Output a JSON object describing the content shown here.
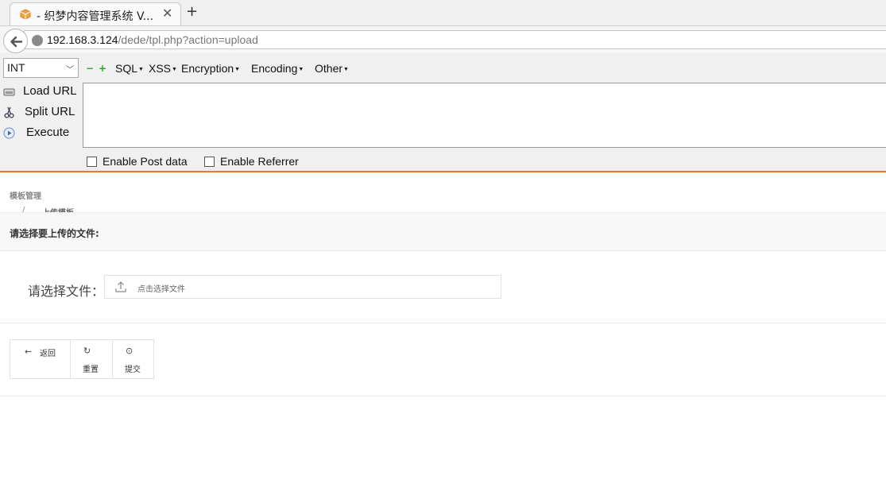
{
  "browser": {
    "tab_title": "- 织梦内容管理系统 V...",
    "tab_close": "✕",
    "new_tab": "+",
    "url_host": "192.168.3.124",
    "url_path": "/dede/tpl.php?action=upload"
  },
  "hackbar": {
    "select_value": "INT",
    "minus": "−",
    "plus": "+",
    "menus": [
      "SQL",
      "XSS",
      "Encryption",
      "Encoding",
      "Other"
    ],
    "load_url": "Load URL",
    "split_url": "Split URL",
    "execute": "Execute",
    "enable_post": "Enable Post data",
    "enable_referrer": "Enable Referrer"
  },
  "page": {
    "breadcrumb_parent": "模板管理",
    "breadcrumb_sep": "/",
    "breadcrumb_current": "上传模板",
    "section_title": "请选择要上传的文件:",
    "file_label": "请选择文件：",
    "upload_placeholder": "点击选择文件",
    "buttons": {
      "back_icon": "←",
      "back": "返回",
      "reset_icon": "↻",
      "reset": "重置",
      "submit_icon": "⊙",
      "submit": "提交"
    }
  },
  "colors": {
    "accent_orange": "#e07b2f",
    "plus_minus_green": "#2aa52a"
  }
}
